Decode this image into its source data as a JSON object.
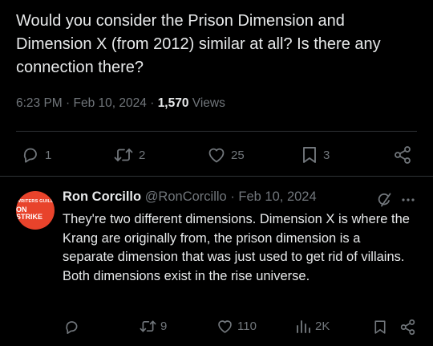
{
  "tweet": {
    "text": "Would you consider the Prison Dimension and Dimension X (from 2012) similar at all? Is there any connection there?",
    "time": "6:23 PM",
    "date": "Feb 10, 2024",
    "separator": "·",
    "views_count": "1,570",
    "views_label": "Views",
    "stats": {
      "replies": "1",
      "reposts": "2",
      "likes": "25",
      "bookmarks": "3"
    }
  },
  "reply": {
    "avatar": {
      "line1": "WRITERS GUILD",
      "line2": "ON STRIKE"
    },
    "name": "Ron Corcillo",
    "handle": "@RonCorcillo",
    "separator": "·",
    "date": "Feb 10, 2024",
    "text": "They're two different dimensions. Dimension X is where the Krang are originally from, the prison dimension is a separate dimension that was just used to get rid of villains. Both dimensions exist in the rise universe.",
    "stats": {
      "reposts": "9",
      "likes": "110",
      "views": "2K"
    }
  },
  "colors": {
    "background": "#000000",
    "text_primary": "#e7e9ea",
    "text_secondary": "#71767b",
    "divider": "#2f3336",
    "avatar_bg": "#e8432b"
  },
  "icons": [
    "reply-icon",
    "repost-icon",
    "like-icon",
    "bookmark-icon",
    "share-icon",
    "grok-icon",
    "more-icon",
    "views-icon"
  ]
}
